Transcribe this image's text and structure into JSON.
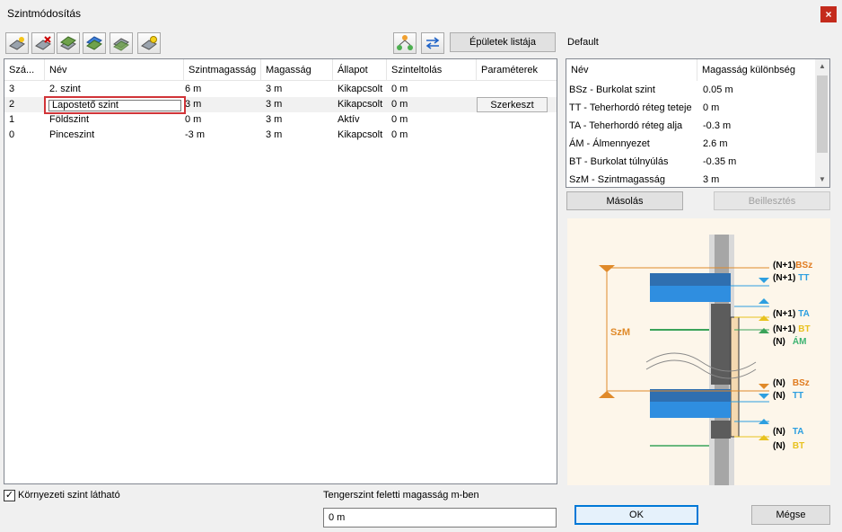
{
  "window": {
    "title": "Szintmódosítás",
    "close_label": "×"
  },
  "toolbar": {
    "icons": [
      "add-level-icon",
      "delete-level-icon",
      "insert-level-above-icon",
      "insert-level-below-icon",
      "edit-level-icon",
      "level-settings-icon",
      "hierarchy-icon",
      "swap-arrows-icon"
    ],
    "buildings_list_label": "Épületek listája"
  },
  "levels": {
    "columns": [
      "Szá...",
      "Név",
      "Szintmagasság",
      "Magasság",
      "Állapot",
      "Szinteltolás",
      "Paraméterek"
    ],
    "rows": [
      {
        "num": "3",
        "name": "2. szint",
        "level_height": "6 m",
        "height": "3 m",
        "state": "Kikapcsolt",
        "offset": "0 m",
        "param": ""
      },
      {
        "num": "2",
        "name": "Lapostető szint",
        "level_height": "3 m",
        "height": "3 m",
        "state": "Kikapcsolt",
        "offset": "0 m",
        "param": "Szerkeszt"
      },
      {
        "num": "1",
        "name": "Földszint",
        "level_height": "0 m",
        "height": "3 m",
        "state": "Aktív",
        "offset": "0 m",
        "param": ""
      },
      {
        "num": "0",
        "name": "Pinceszint",
        "level_height": "-3 m",
        "height": "3 m",
        "state": "Kikapcsolt",
        "offset": "0 m",
        "param": ""
      }
    ],
    "edit_value": "Lapostető szint"
  },
  "properties": {
    "profile_name": "Default",
    "columns": [
      "Név",
      "Magasság különbség"
    ],
    "rows": [
      {
        "name": "BSz - Burkolat szint",
        "value": "0.05 m"
      },
      {
        "name": "TT - Teherhordó réteg teteje",
        "value": "0 m"
      },
      {
        "name": "TA - Teherhordó réteg alja",
        "value": "-0.3 m"
      },
      {
        "name": "ÁM - Álmennyezet",
        "value": "2.6 m"
      },
      {
        "name": "BT - Burkolat túlnyúlás",
        "value": "-0.35 m"
      },
      {
        "name": "SzM - Szintmagasság",
        "value": "3 m"
      }
    ],
    "copy_label": "Másolás",
    "paste_label": "Beillesztés"
  },
  "diagram": {
    "height_label": "SzM",
    "upper_labels": [
      {
        "prefix": "(N+1)",
        "code": "BSz",
        "color": "#e07b1f"
      },
      {
        "prefix": "(N+1)",
        "code": "TT",
        "color": "#2d9fe0"
      },
      {
        "prefix": "(N+1)",
        "code": "TA",
        "color": "#2d9fe0"
      },
      {
        "prefix": "(N+1)",
        "code": "BT",
        "color": "#e8c21f"
      },
      {
        "prefix": "(N)",
        "code": "ÁM",
        "color": "#3cb371"
      }
    ],
    "lower_labels": [
      {
        "prefix": "(N)",
        "code": "BSz",
        "color": "#e07b1f"
      },
      {
        "prefix": "(N)",
        "code": "TT",
        "color": "#2d9fe0"
      },
      {
        "prefix": "(N)",
        "code": "TA",
        "color": "#2d9fe0"
      },
      {
        "prefix": "(N)",
        "code": "BT",
        "color": "#e8c21f"
      }
    ]
  },
  "footer": {
    "env_level_label": "Környezeti szint látható",
    "env_level_checked": "✓",
    "sea_level_label": "Tengerszint feletti magasság m-ben",
    "sea_level_value": "0 m",
    "ok_label": "OK",
    "cancel_label": "Mégse"
  }
}
